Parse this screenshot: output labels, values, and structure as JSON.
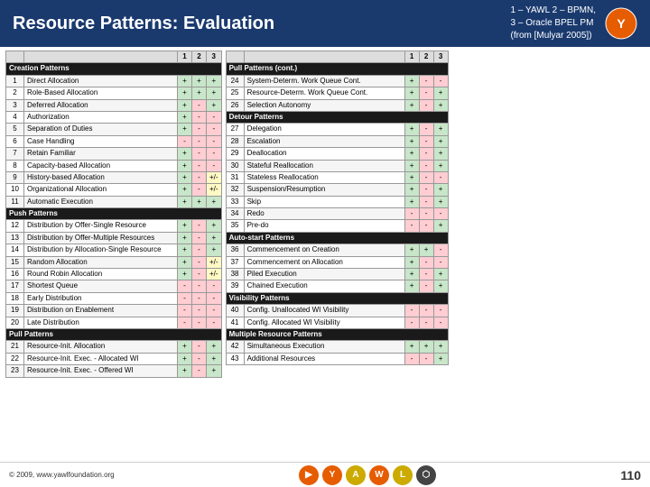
{
  "header": {
    "title": "Resource Patterns: Evaluation",
    "subtitle_line1": "1 – YAWL  2 – BPMN,",
    "subtitle_line2": "3 – Oracle BPEL PM",
    "subtitle_line3": "(from [Mulyar 2005])"
  },
  "col_headers": [
    "1",
    "2",
    "3"
  ],
  "left_table": {
    "sections": [
      {
        "title": "Creation Patterns",
        "rows": [
          {
            "id": "1",
            "name": "Direct Allocation",
            "v1": "+",
            "v2": "+",
            "v3": "+"
          },
          {
            "id": "2",
            "name": "Role-Based Allocation",
            "v1": "+",
            "v2": "+",
            "v3": "+"
          },
          {
            "id": "3",
            "name": "Deferred Allocation",
            "v1": "+",
            "v2": "-",
            "v3": "+"
          },
          {
            "id": "4",
            "name": "Authorization",
            "v1": "+",
            "v2": "-",
            "v3": "-"
          },
          {
            "id": "5",
            "name": "Separation of Duties",
            "v1": "+",
            "v2": "-",
            "v3": "-"
          },
          {
            "id": "6",
            "name": "Case Handling",
            "v1": "-",
            "v2": "-",
            "v3": "-"
          },
          {
            "id": "7",
            "name": "Retain Familiar",
            "v1": "+",
            "v2": "-",
            "v3": "-"
          },
          {
            "id": "8",
            "name": "Capacity-based Allocation",
            "v1": "+",
            "v2": "-",
            "v3": "-"
          },
          {
            "id": "9",
            "name": "History-based Allocation",
            "v1": "+",
            "v2": "-",
            "v3": "+/-"
          }
        ]
      },
      {
        "title": null,
        "rows": [
          {
            "id": "10",
            "name": "Organizational Allocation",
            "v1": "+",
            "v2": "-",
            "v3": "+/-"
          },
          {
            "id": "11",
            "name": "Automatic Execution",
            "v1": "+",
            "v2": "+",
            "v3": "+"
          }
        ]
      },
      {
        "title": "Push Patterns",
        "rows": [
          {
            "id": "12",
            "name": "Distribution by Offer-Single Resource",
            "v1": "+",
            "v2": "-",
            "v3": "+"
          },
          {
            "id": "13",
            "name": "Distribution by Offer-Multiple Resources",
            "v1": "+",
            "v2": "-",
            "v3": "+"
          },
          {
            "id": "14",
            "name": "Distribution by Allocation-Single Resource",
            "v1": "+",
            "v2": "-",
            "v3": "+"
          },
          {
            "id": "15",
            "name": "Random Allocation",
            "v1": "+",
            "v2": "-",
            "v3": "+/-"
          },
          {
            "id": "16",
            "name": "Round Robin Allocation",
            "v1": "+",
            "v2": "-",
            "v3": "+/-"
          },
          {
            "id": "17",
            "name": "Shortest Queue",
            "v1": "-",
            "v2": "-",
            "v3": "-"
          },
          {
            "id": "18",
            "name": "Early Distribution",
            "v1": "-",
            "v2": "-",
            "v3": "-"
          },
          {
            "id": "19",
            "name": "Distribution on Enablement",
            "v1": "-",
            "v2": "-",
            "v3": "-"
          },
          {
            "id": "20",
            "name": "Late Distribution",
            "v1": "-",
            "v2": "-",
            "v3": "-"
          }
        ]
      },
      {
        "title": "Pull Patterns",
        "rows": [
          {
            "id": "21",
            "name": "Resource-Init. Allocation",
            "v1": "+",
            "v2": "-",
            "v3": "+"
          },
          {
            "id": "22",
            "name": "Resource-Init. Exec. - Allocated WI",
            "v1": "+",
            "v2": "-",
            "v3": "+"
          },
          {
            "id": "23",
            "name": "Resource-Init. Exec. - Offered WI",
            "v1": "+",
            "v2": "-",
            "v3": "+"
          }
        ]
      }
    ]
  },
  "right_table": {
    "sections": [
      {
        "title": "Pull Patterns (cont.)",
        "rows": [
          {
            "id": "24",
            "name": "System-Determ. Work Queue Cont.",
            "v1": "+",
            "v2": "-",
            "v3": "-"
          },
          {
            "id": "25",
            "name": "Resource-Determ. Work Queue Cont.",
            "v1": "+",
            "v2": "-",
            "v3": "+"
          },
          {
            "id": "26",
            "name": "Selection Autonomy",
            "v1": "+",
            "v2": "-",
            "v3": "+"
          }
        ]
      },
      {
        "title": "Detour Patterns",
        "rows": [
          {
            "id": "27",
            "name": "Delegation",
            "v1": "+",
            "v2": "-",
            "v3": "+"
          },
          {
            "id": "28",
            "name": "Escalation",
            "v1": "+",
            "v2": "-",
            "v3": "+"
          },
          {
            "id": "29",
            "name": "Deallocation",
            "v1": "+",
            "v2": "-",
            "v3": "+"
          },
          {
            "id": "30",
            "name": "Stateful Reallocation",
            "v1": "+",
            "v2": "-",
            "v3": "+"
          },
          {
            "id": "31",
            "name": "Stateless Reallocation",
            "v1": "+",
            "v2": "-",
            "v3": "-"
          },
          {
            "id": "32",
            "name": "Suspension/Resumption",
            "v1": "+",
            "v2": "-",
            "v3": "+"
          },
          {
            "id": "33",
            "name": "Skip",
            "v1": "+",
            "v2": "-",
            "v3": "+"
          },
          {
            "id": "34",
            "name": "Redo",
            "v1": "-",
            "v2": "-",
            "v3": "-"
          },
          {
            "id": "35",
            "name": "Pre-do",
            "v1": "-",
            "v2": "-",
            "v3": "+"
          }
        ]
      },
      {
        "title": "Auto-start Patterns",
        "rows": [
          {
            "id": "36",
            "name": "Commencement on Creation",
            "v1": "+",
            "v2": "+",
            "v3": "-"
          },
          {
            "id": "37",
            "name": "Commencement on Allocation",
            "v1": "+",
            "v2": "-",
            "v3": "-"
          },
          {
            "id": "38",
            "name": "Piled Execution",
            "v1": "+",
            "v2": "-",
            "v3": "+"
          },
          {
            "id": "39",
            "name": "Chained Execution",
            "v1": "+",
            "v2": "-",
            "v3": "+"
          }
        ]
      },
      {
        "title": "Visibility Patterns",
        "rows": [
          {
            "id": "40",
            "name": "Config. Unallocated WI Visibility",
            "v1": "-",
            "v2": "-",
            "v3": "-"
          },
          {
            "id": "41",
            "name": "Config. Allocated WI Visibility",
            "v1": "-",
            "v2": "-",
            "v3": "-"
          }
        ]
      },
      {
        "title": "Multiple Resource Patterns",
        "rows": [
          {
            "id": "42",
            "name": "Simultaneous Execution",
            "v1": "+",
            "v2": "+",
            "v3": "+"
          },
          {
            "id": "43",
            "name": "Additional Resources",
            "v1": "-",
            "v2": "-",
            "v3": "+"
          }
        ]
      }
    ]
  },
  "footer": {
    "copyright": "© 2009, www.yawlfoundation.org",
    "page_number": "110",
    "nav_items": [
      {
        "label": "▶",
        "color": "#e65c00"
      },
      {
        "label": "Y",
        "color": "#e65c00"
      },
      {
        "label": "A",
        "color": "#ccaa00"
      },
      {
        "label": "W",
        "color": "#e65c00"
      },
      {
        "label": "L",
        "color": "#ccaa00"
      },
      {
        "label": "⬡",
        "color": "#333"
      }
    ]
  }
}
